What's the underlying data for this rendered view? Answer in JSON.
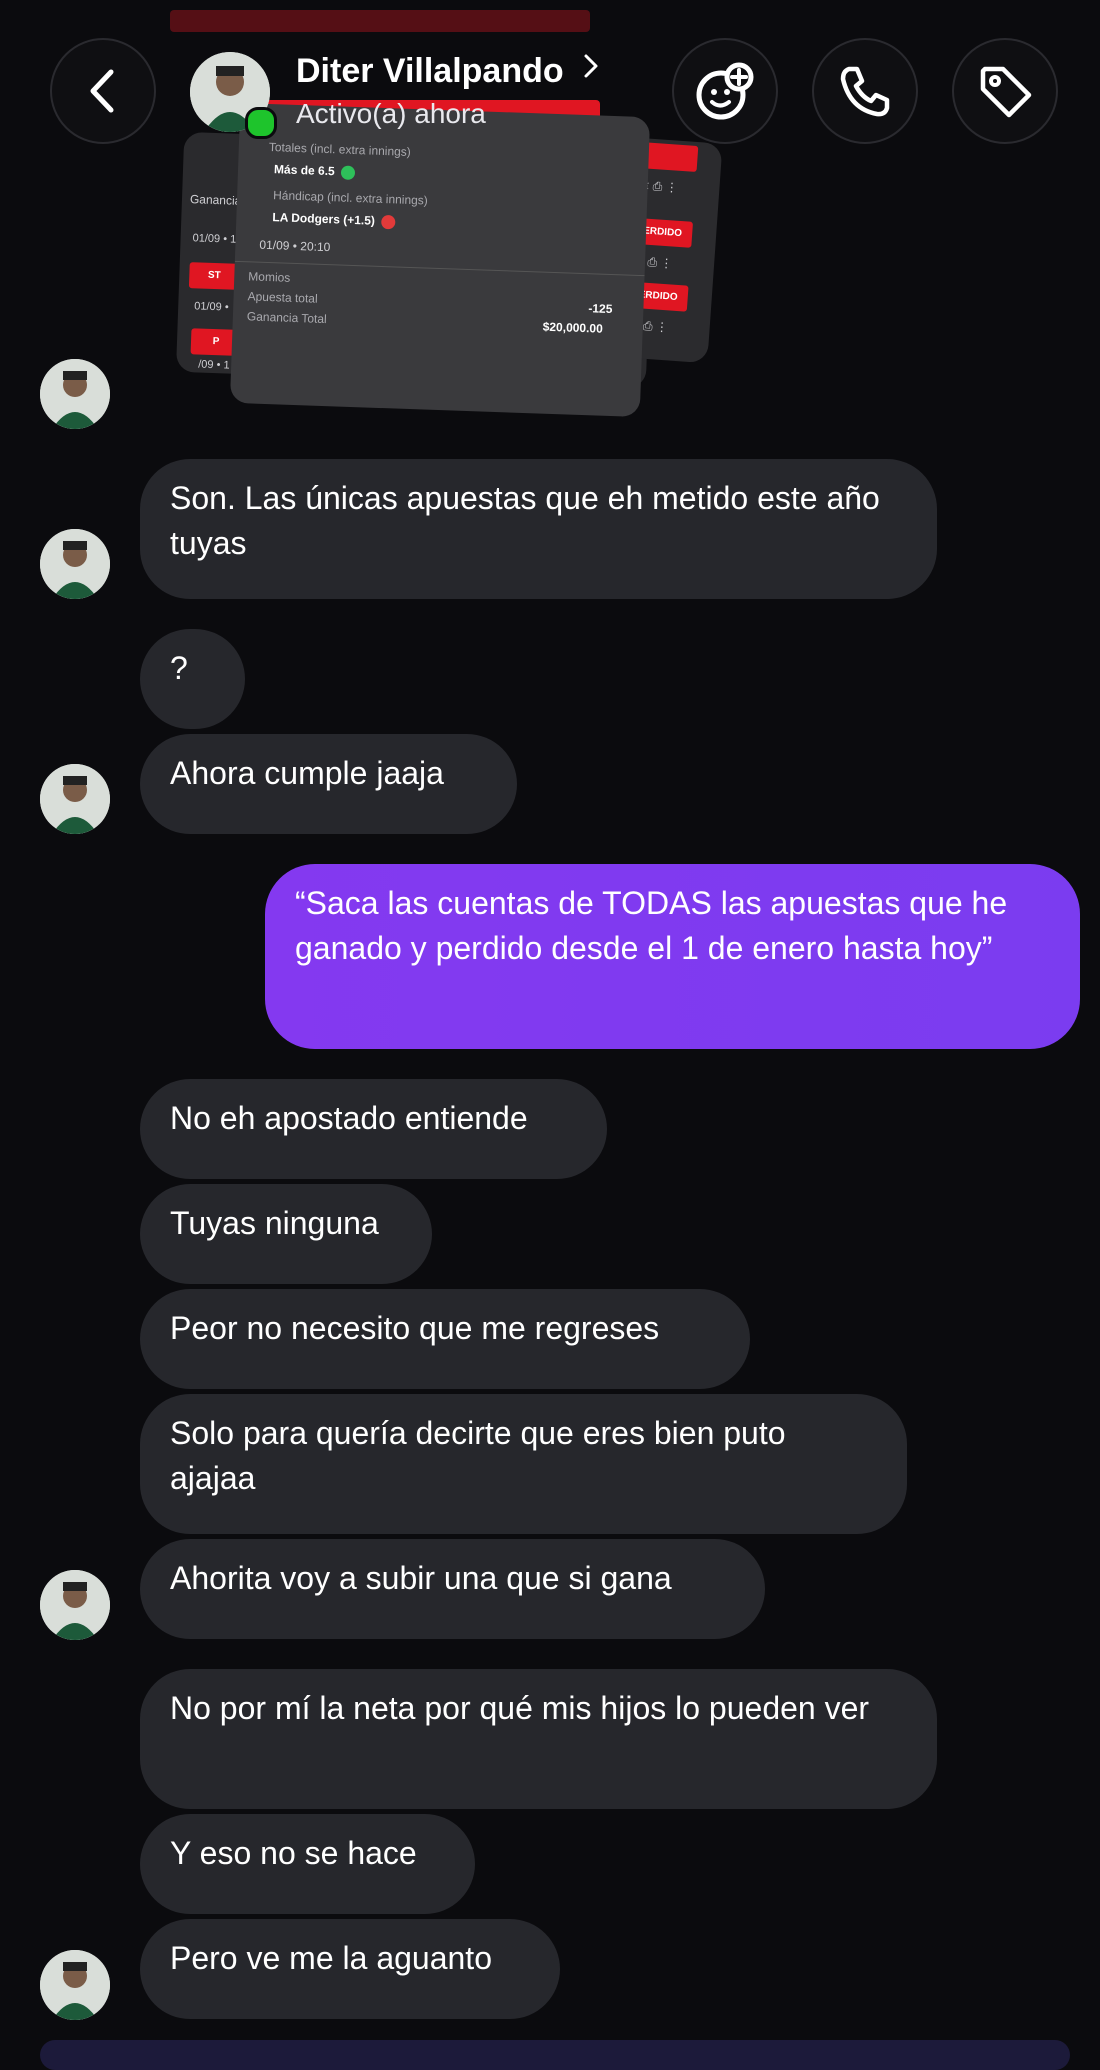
{
  "header": {
    "name": "Diter Villalpando",
    "status": "Activo(a) ahora"
  },
  "bet_slip": {
    "rows": [
      {
        "label": "Totales (incl. extra innings)"
      },
      {
        "label": "Más de 6.5"
      },
      {
        "label": "Hándicap (incl. extra innings)"
      },
      {
        "label": "LA Dodgers (+1.5)"
      },
      {
        "label": "01/09 • 20:10"
      }
    ],
    "bet_type": "Momios",
    "odds": "-125",
    "stake_label": "Apuesta total",
    "winnings_label": "Ganancia Total",
    "winnings_value": "$20,000.00",
    "lost_label": "PERDIDO",
    "back_labels": [
      "Ganancia",
      "01/09 • 1",
      "01/09 •",
      "/09 • 1"
    ],
    "back_badges": [
      "ST",
      "P"
    ]
  },
  "messages": [
    {
      "text": "Son. Las únicas apuestas que eh metido este año tuyas",
      "direction": "in"
    },
    {
      "text": "?",
      "direction": "in"
    },
    {
      "text": "Ahora cumple  jaaja",
      "direction": "in"
    },
    {
      "text": "“Saca las cuentas de TODAS las apuestas que he ganado y perdido desde el 1 de enero hasta hoy”",
      "direction": "out"
    },
    {
      "text": "No eh apostado entiende",
      "direction": "in"
    },
    {
      "text": "Tuyas ninguna",
      "direction": "in"
    },
    {
      "text": "Peor no necesito que me regreses",
      "direction": "in"
    },
    {
      "text": "Solo para quería decirte que eres bien puto ajajaa",
      "direction": "in"
    },
    {
      "text": "Ahorita voy a subir una que si gana",
      "direction": "in"
    },
    {
      "text": "No por mí la neta por qué mis hijos lo pueden ver",
      "direction": "in"
    },
    {
      "text": "Y eso no se hace",
      "direction": "in"
    },
    {
      "text": "Pero ve me la aguanto",
      "direction": "in"
    }
  ],
  "colors": {
    "background": "#0b0b0e",
    "incoming_bubble": "#26272c",
    "outgoing_bubble": "#7c3aed",
    "online": "#1ec42c",
    "lost_red": "#e01622"
  },
  "icons": [
    "back-chevron-icon",
    "chevron-right-icon",
    "sticker-add-icon",
    "phone-icon",
    "tag-icon",
    "check-icon",
    "x-icon"
  ]
}
